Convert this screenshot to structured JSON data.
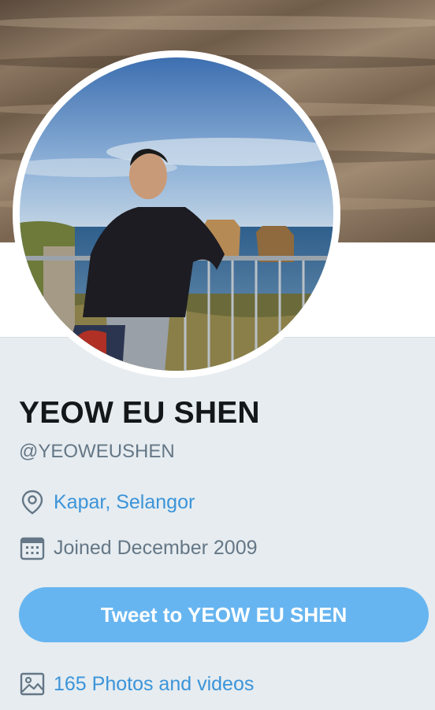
{
  "profile": {
    "name": "YEOW EU SHEN",
    "handle": "@YEOWEUSHEN",
    "location": "Kapar, Selangor",
    "joined": "Joined December 2009",
    "tweet_button_label": "Tweet to YEOW EU SHEN",
    "photos_link": "165 Photos and videos"
  },
  "icons": {
    "location": "location-pin-icon",
    "joined": "calendar-icon",
    "photos": "image-icon"
  },
  "colors": {
    "link": "#3b94d9",
    "button": "#66b5f0",
    "background": "#e6ecf0",
    "muted": "#657786"
  }
}
